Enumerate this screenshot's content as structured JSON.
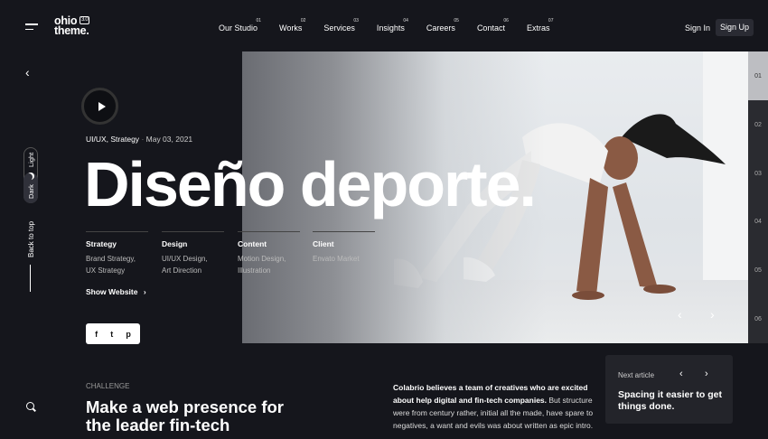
{
  "header": {
    "logo_line1": "ohio",
    "logo_line2": "theme.",
    "logo_badge": "3.0",
    "nav": [
      {
        "label": "Our Studio",
        "num": "01"
      },
      {
        "label": "Works",
        "num": "02"
      },
      {
        "label": "Services",
        "num": "03"
      },
      {
        "label": "Insights",
        "num": "04"
      },
      {
        "label": "Careers",
        "num": "05"
      },
      {
        "label": "Contact",
        "num": "06"
      },
      {
        "label": "Extras",
        "num": "07"
      }
    ],
    "signin": "Sign In",
    "signup": "Sign Up"
  },
  "left_rail": {
    "theme_light": "Light",
    "theme_dark": "Dark",
    "back_to_top": "Back to top",
    "back_icon": "chevron-left-icon",
    "search_icon": "search-icon"
  },
  "hero": {
    "meta_tags": "UI/UX, Strategy",
    "meta_date": "May 03, 2021",
    "title": "Diseño deporte.",
    "info": [
      {
        "heading": "Strategy",
        "values": [
          "Brand Strategy,",
          "UX Strategy"
        ]
      },
      {
        "heading": "Design",
        "values": [
          "UI/UX Design,",
          "Art Direction"
        ]
      },
      {
        "heading": "Content",
        "values": [
          "Motion Design,",
          "Illustration"
        ]
      },
      {
        "heading": "Client",
        "values": [
          "Envato Market",
          ""
        ]
      }
    ],
    "show_website": "Show Website",
    "share": [
      "f",
      "t",
      "p"
    ]
  },
  "slider": {
    "pages": [
      "01",
      "02",
      "03",
      "04",
      "05",
      "06"
    ],
    "active_index": 0
  },
  "challenge": {
    "label": "CHALLENGE",
    "title": "Make a web presence for the leader fin-tech",
    "body_bold": "Colabrio believes a team of creatives who are excited about help digital and fin-tech companies.",
    "body_rest": " But structure were from century rather, initial all the made, have spare to negatives, a want and evils was about written as epic intro."
  },
  "next_article": {
    "label": "Next article",
    "title": "Spacing it easier to get things done."
  }
}
